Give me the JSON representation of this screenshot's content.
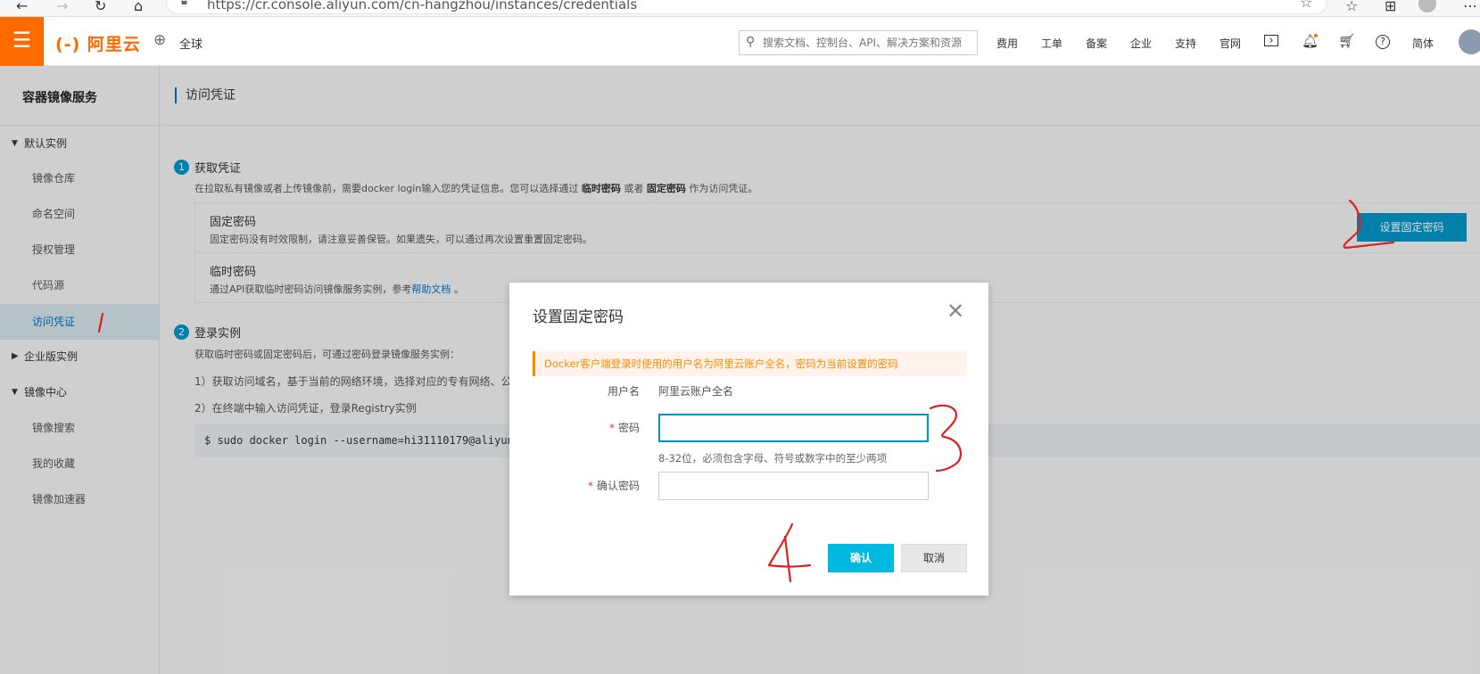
{
  "browser": {
    "url": "https://cr.console.aliyun.com/cn-hangzhou/instances/credentials"
  },
  "topnav": {
    "logo_text": "(-) 阿里云",
    "region_label": "全球",
    "search_placeholder": "搜索文档、控制台、API、解决方案和资源",
    "links": [
      "费用",
      "工单",
      "备案",
      "企业",
      "支持",
      "官网"
    ],
    "lang_label": "简体",
    "accent_color": "#ff6a00"
  },
  "sidebar": {
    "title": "容器镜像服务",
    "groups": [
      {
        "label": "默认实例",
        "expanded": true,
        "items": [
          "镜像仓库",
          "命名空间",
          "授权管理",
          "代码源",
          "访问凭证"
        ]
      },
      {
        "label": "企业版实例",
        "expanded": false,
        "items": []
      },
      {
        "label": "镜像中心",
        "expanded": true,
        "items": [
          "镜像搜索",
          "我的收藏",
          "镜像加速器"
        ]
      }
    ],
    "active_item": "访问凭证"
  },
  "content": {
    "page_title": "访问凭证",
    "step1": {
      "num": "1",
      "title": "获取凭证",
      "desc_prefix": "在拉取私有镜像或者上传镜像前，需要docker login输入您的凭证信息。您可以选择通过 ",
      "desc_temp": "临时密码",
      "desc_mid": " 或者 ",
      "desc_fixed": "固定密码",
      "desc_suffix": " 作为访问凭证。",
      "fixed": {
        "name": "固定密码",
        "desc": "固定密码没有时效限制，请注意妥善保管。如果遗失，可以通过再次设置重置固定密码。",
        "button": "设置固定密码"
      },
      "temp": {
        "name": "临时密码",
        "desc_prefix": "通过API获取临时密码访问镜像服务实例，参考",
        "link": "帮助文档",
        "desc_suffix": " 。"
      }
    },
    "step2": {
      "num": "2",
      "title": "登录实例",
      "desc": "获取临时密码或固定密码后，可通过密码登录镜像服务实例：",
      "line1": "1）获取访问域名，基于当前的网络环境，选择对应的专有网络、公",
      "line2": "2）在终端中输入访问凭证，登录Registry实例",
      "command": "$ sudo docker login --username=hi31110179@aliyun."
    }
  },
  "modal": {
    "title": "设置固定密码",
    "alert": "Docker客户端登录时使用的用户名为阿里云账户全名，密码为当前设置的密码",
    "username_label": "用户名",
    "username_value": "阿里云账户全名",
    "password_label": "密码",
    "password_value": "",
    "password_hint": "8-32位，必须包含字母、符号或数字中的至少两项",
    "confirm_label": "确认密码",
    "confirm_value": "",
    "ok_button": "确认",
    "cancel_button": "取消"
  },
  "annotations": [
    "1",
    "2",
    "3",
    "4"
  ]
}
